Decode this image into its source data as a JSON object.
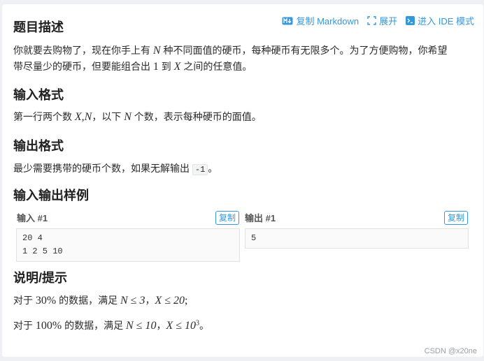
{
  "header": {
    "title": "题目描述",
    "actions": [
      {
        "label": "复制 Markdown",
        "icon": "markdown-icon"
      },
      {
        "label": "展开",
        "icon": "expand-icon"
      },
      {
        "label": "进入 IDE 模式",
        "icon": "ide-icon"
      }
    ]
  },
  "description": {
    "p1": "你就要去购物了，现在你手上有",
    "v_n": "N",
    "p2": "种不同面值的硬币，每种硬币有无限多个。为了方便购物，你希望",
    "p3": "带尽量少的硬币，但要能组合出",
    "v_one": "1",
    "p4": "到",
    "v_x": "X",
    "p5": "之间的任意值。"
  },
  "input_format": {
    "title": "输入格式",
    "p1": "第一行两个数",
    "v_x": "X",
    "comma": ",",
    "v_n": "N",
    "p2": "，以下",
    "v_n2": "N",
    "p3": "个数，表示每种硬币的面值。"
  },
  "output_format": {
    "title": "输出格式",
    "p1": "最少需要携带的硬币个数，如果无解输出",
    "code": "-1",
    "p2": "。"
  },
  "samples": {
    "title": "输入输出样例",
    "input_label": "输入 #1",
    "output_label": "输出 #1",
    "copy_label": "复制",
    "input_text": "20 4\n1 2 5 10",
    "output_text": "5"
  },
  "hints": {
    "title": "说明/提示",
    "line1": {
      "p1": "对于",
      "pct": "30%",
      "p2": "的数据，满足",
      "cond1": "N ≤ 3",
      "sep": "，",
      "cond2": "X ≤ 20",
      "end": ";"
    },
    "line2": {
      "p1": "对于",
      "pct": "100%",
      "p2": "的数据，满足",
      "cond1": "N ≤ 10",
      "sep": "，",
      "cond2_base": "X ≤ 10",
      "cond2_exp": "3",
      "end": "。"
    }
  },
  "watermark": "CSDN @x20ne",
  "colors": {
    "accent": "#3498db",
    "text": "#262626",
    "background": "#eef0f3"
  }
}
